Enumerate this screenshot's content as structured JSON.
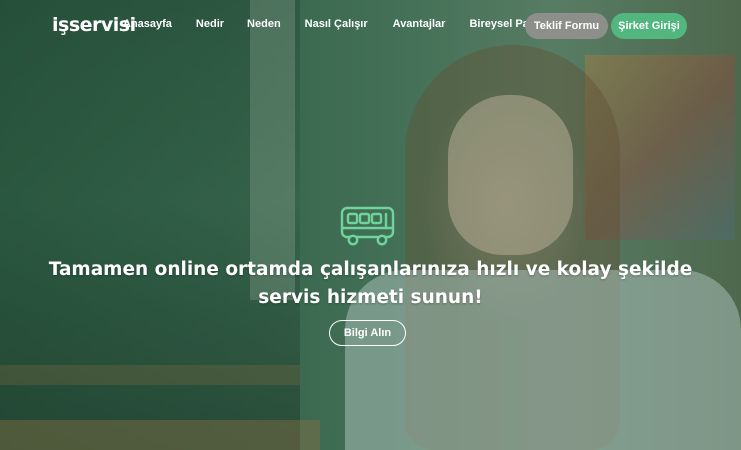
{
  "brand": {
    "logo_text": "işservisi"
  },
  "nav": {
    "items": [
      {
        "label": "Anasayfa"
      },
      {
        "label": "Nedir"
      },
      {
        "label": "Neden"
      },
      {
        "label": "Nasıl Çalışır"
      },
      {
        "label": "Avantajlar"
      },
      {
        "label": "Bireysel Paketler"
      }
    ],
    "teklif_label": "Teklif Formu",
    "giris_label": "Şirket Girişi"
  },
  "hero": {
    "icon": "bus-icon",
    "headline": "Tamamen online ortamda çalışanlarınıza hızlı ve kolay şekilde servis hizmeti sunun!",
    "cta_label": "Bilgi Alın"
  },
  "colors": {
    "accent_green": "#52b77e",
    "bus_icon_green": "#6fd49b",
    "teklif_gray": "#8c8f8a",
    "overlay_green": "#3c6a50"
  }
}
